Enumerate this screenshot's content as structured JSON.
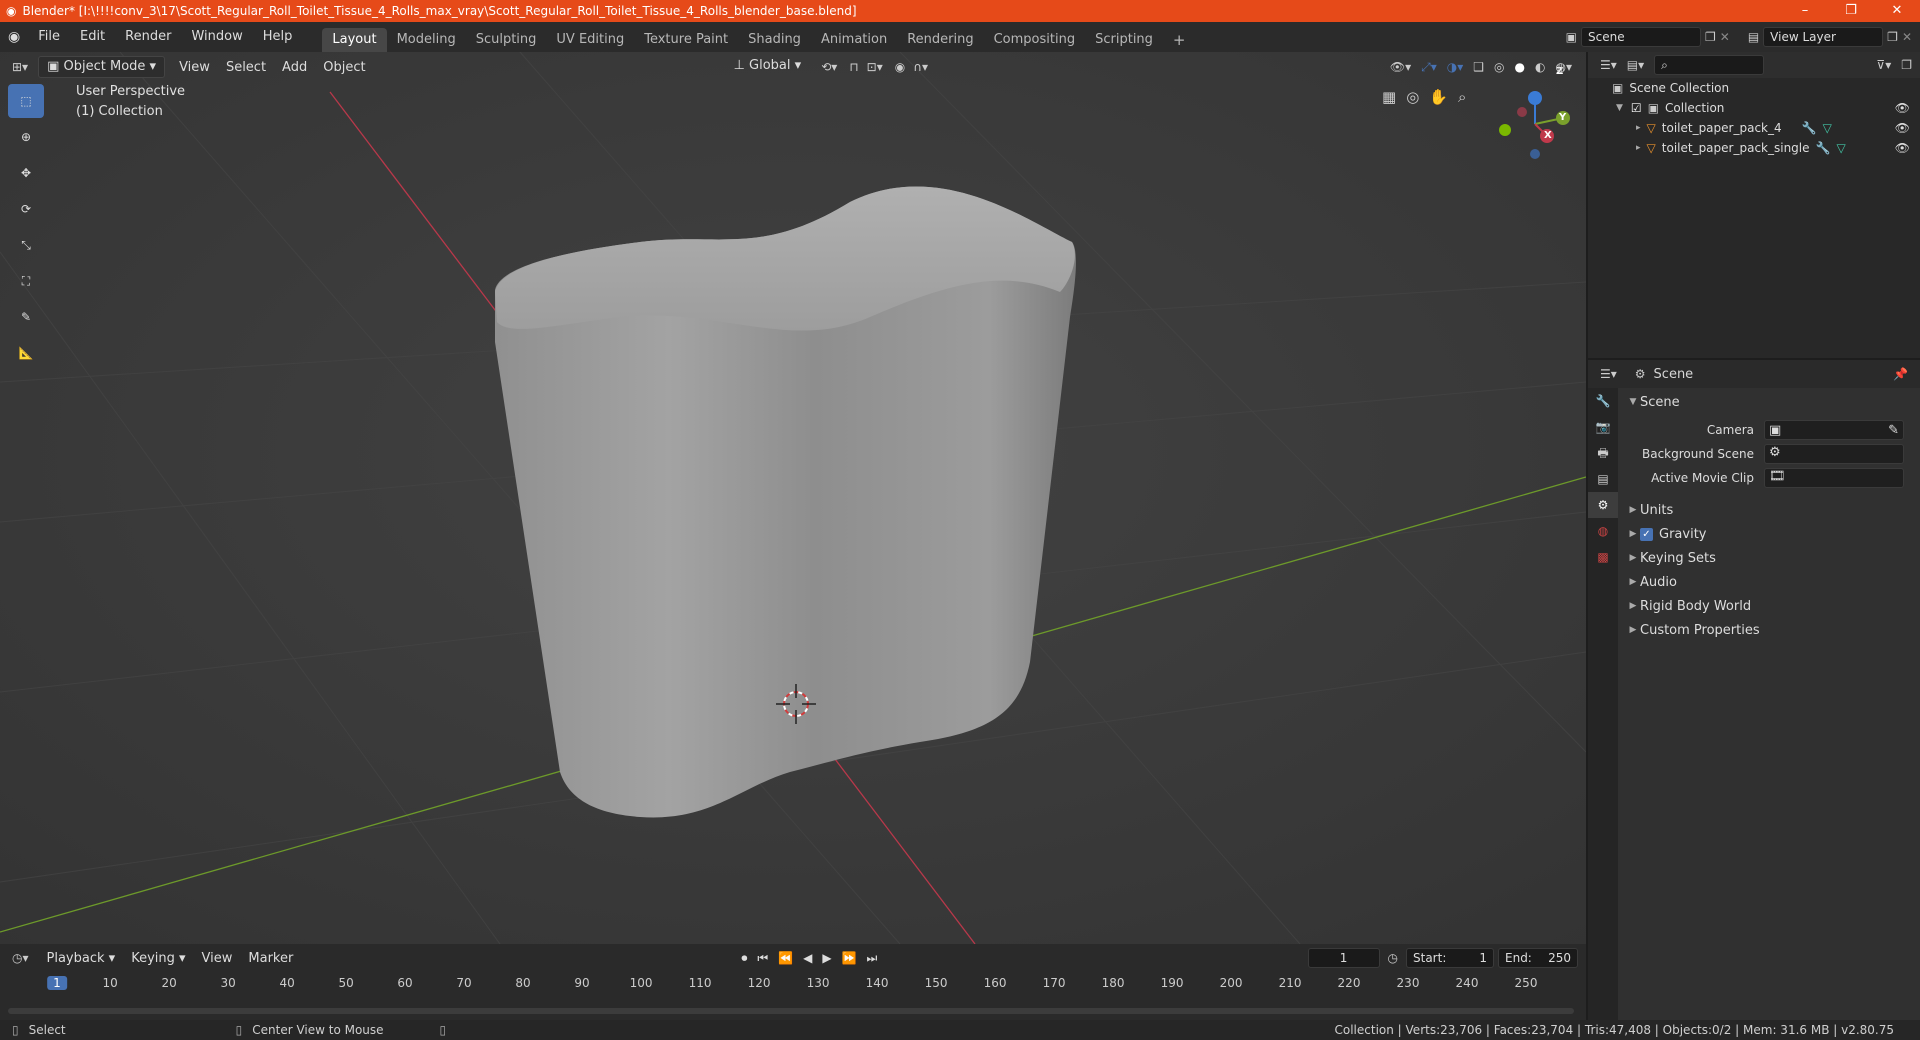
{
  "titlebar": {
    "title": "Blender* [I:\\!!!!conv_3\\17\\Scott_Regular_Roll_Toilet_Tissue_4_Rolls_max_vray\\Scott_Regular_Roll_Toilet_Tissue_4_Rolls_blender_base.blend]",
    "minimize": "–",
    "maximize": "❐",
    "close": "✕"
  },
  "menu": [
    "File",
    "Edit",
    "Render",
    "Window",
    "Help"
  ],
  "workspaces": [
    "Layout",
    "Modeling",
    "Sculpting",
    "UV Editing",
    "Texture Paint",
    "Shading",
    "Animation",
    "Rendering",
    "Compositing",
    "Scripting"
  ],
  "add_workspace": "+",
  "scene_field": "Scene",
  "view_layer_field": "View Layer",
  "viewport": {
    "mode": "Object Mode",
    "menus": [
      "View",
      "Select",
      "Add",
      "Object"
    ],
    "transform": "Global",
    "perspective": "User Perspective",
    "collection": "(1) Collection",
    "gizmo": {
      "x": "X",
      "y": "Y",
      "z": "Z"
    }
  },
  "outliner": {
    "scene_collection": "Scene Collection",
    "collection": "Collection",
    "items": [
      "toilet_paper_pack_4",
      "toilet_paper_pack_single"
    ]
  },
  "properties": {
    "header": "Scene",
    "panel_title": "Scene",
    "camera_label": "Camera",
    "background_scene_label": "Background Scene",
    "active_movie_clip_label": "Active Movie Clip",
    "sections": [
      "Units",
      "Gravity",
      "Keying Sets",
      "Audio",
      "Rigid Body World",
      "Custom Properties"
    ],
    "gravity_checked": true
  },
  "timeline": {
    "menus": [
      "Playback",
      "Keying",
      "View",
      "Marker"
    ],
    "current_frame": "1",
    "start_label": "Start:",
    "start": "1",
    "end_label": "End:",
    "end": "250",
    "ticks": [
      "1",
      "10",
      "20",
      "30",
      "40",
      "50",
      "60",
      "70",
      "80",
      "90",
      "100",
      "110",
      "120",
      "130",
      "140",
      "150",
      "160",
      "170",
      "180",
      "190",
      "200",
      "210",
      "220",
      "230",
      "240",
      "250"
    ]
  },
  "statusbar": {
    "select": "Select",
    "center_view": "Center View to Mouse",
    "stats": "Collection | Verts:23,706 | Faces:23,704 | Tris:47,408 | Objects:0/2 | Mem: 31.6 MB | v2.80.75"
  },
  "colors": {
    "accent": "#4772b3",
    "titlebar": "#e64a19",
    "x_axis": "#c0394b",
    "y_axis": "#7aa02c",
    "object_orange": "#e8912d"
  }
}
